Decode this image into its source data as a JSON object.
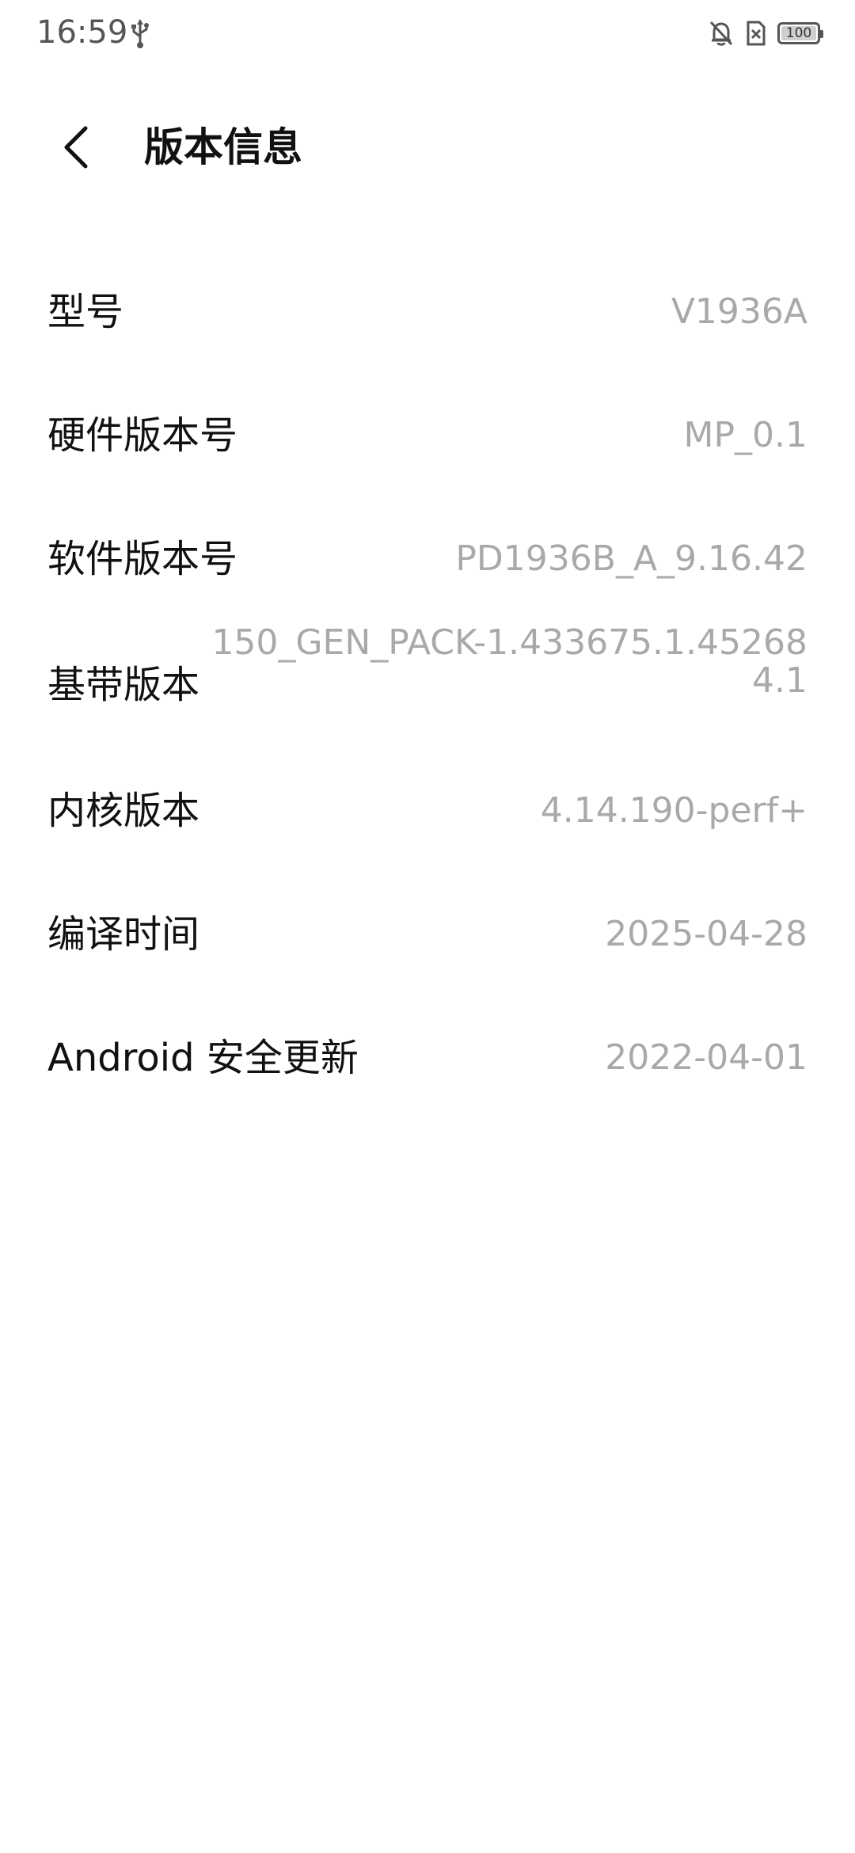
{
  "status_bar": {
    "time": "16:59",
    "battery_level": "100",
    "icons": [
      "usb-icon",
      "bell-off-icon",
      "no-sim-icon",
      "battery-icon"
    ]
  },
  "header": {
    "title": "版本信息",
    "back_icon": "chevron-left-icon"
  },
  "info_items": [
    {
      "label": "型号",
      "value": "V1936A"
    },
    {
      "label": "硬件版本号",
      "value": "MP_0.1"
    },
    {
      "label": "软件版本号",
      "value": "PD1936B_A_9.16.42"
    },
    {
      "label": "基带版本",
      "value_line1": "150_GEN_PACK-1.433675.1.45268",
      "value_line2": "4.1"
    },
    {
      "label": "内核版本",
      "value": "4.14.190-perf+"
    },
    {
      "label": "编译时间",
      "value": "2025-04-28"
    },
    {
      "label": "Android 安全更新",
      "value": "2022-04-01"
    }
  ],
  "colors": {
    "label": "#111111",
    "value": "#a9a9a9",
    "status": "#555555",
    "background": "#ffffff"
  }
}
